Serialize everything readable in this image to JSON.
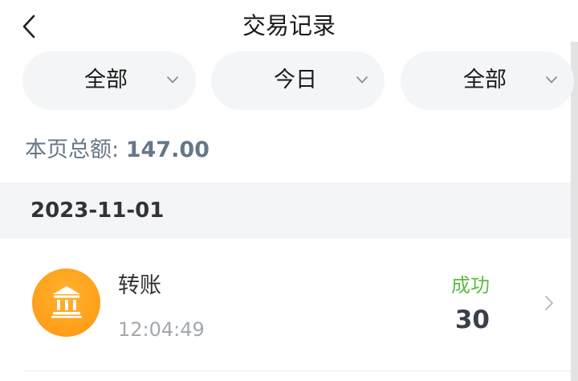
{
  "header": {
    "title": "交易记录",
    "back_icon": "chevron-left-icon"
  },
  "filters": [
    {
      "label": "全部",
      "icon": "chevron-down-icon"
    },
    {
      "label": "今日",
      "icon": "chevron-down-icon"
    },
    {
      "label": "全部",
      "icon": "chevron-down-icon"
    }
  ],
  "summary": {
    "label": "本页总额:",
    "amount": "147.00"
  },
  "groups": [
    {
      "date": "2023-11-01",
      "transactions": [
        {
          "icon": "bank-icon",
          "name": "转账",
          "time": "12:04:49",
          "status": "成功",
          "amount": "30"
        }
      ]
    }
  ],
  "colors": {
    "accent_orange": "#ffa21c",
    "success_green": "#5dbb46",
    "muted_text": "#677787",
    "chip_background": "#f4f5f7"
  }
}
